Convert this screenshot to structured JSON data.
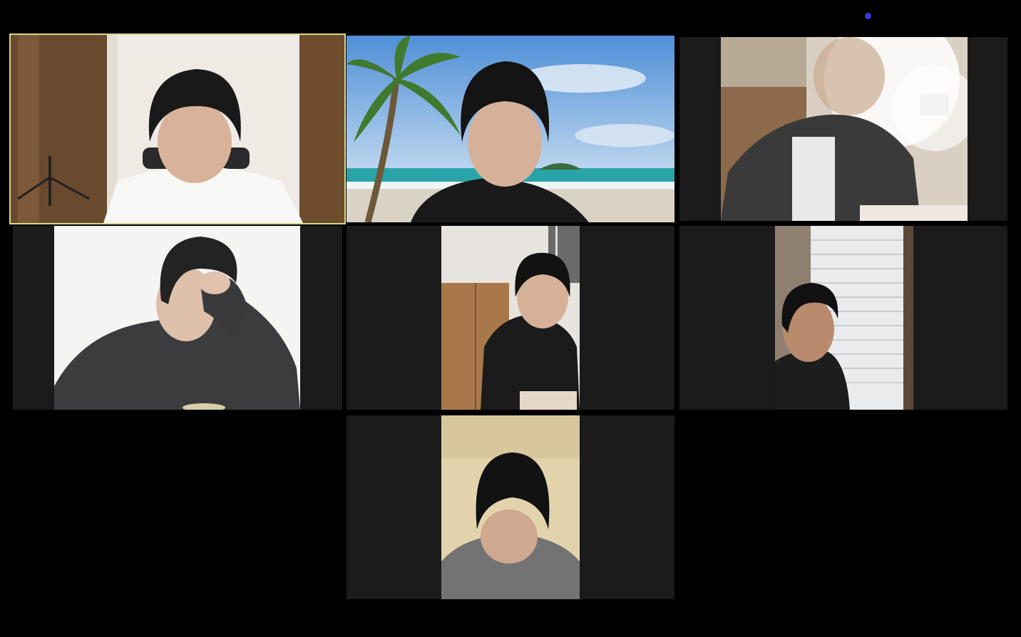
{
  "app": {
    "view": "gallery",
    "status_indicator_color": "#3b3bd6",
    "active_speaker_border_color": "#d7d78a"
  },
  "participants": [
    {
      "id": 1,
      "scene": "room-white-shirt",
      "active_speaker": true
    },
    {
      "id": 2,
      "scene": "virtual-background-beach",
      "active_speaker": false
    },
    {
      "id": 3,
      "scene": "bright-overexposed-room",
      "active_speaker": false
    },
    {
      "id": 4,
      "scene": "white-wall-hoodie",
      "active_speaker": false
    },
    {
      "id": 5,
      "scene": "room-closet",
      "active_speaker": false
    },
    {
      "id": 6,
      "scene": "window-blinds",
      "active_speaker": false
    },
    {
      "id": 7,
      "scene": "gray-sweater-looking-down",
      "active_speaker": false
    }
  ]
}
